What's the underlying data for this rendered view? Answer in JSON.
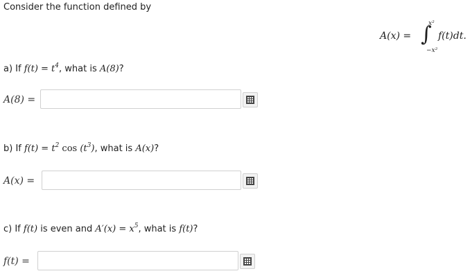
{
  "intro": "Consider the function defined by",
  "formula": {
    "lhs": "A(x) =",
    "upper_limit": "x²",
    "lower_limit": "−x²",
    "integrand": "f(t)dt."
  },
  "parts": [
    {
      "prefix": "a) If ",
      "condition_math": "f(t) = t",
      "condition_sup": "4",
      "question_sep": ", what is ",
      "target_math": "A(8)",
      "suffix": "?",
      "answer_label": "A(8) =",
      "answer_value": "",
      "answer_placeholder": ""
    },
    {
      "prefix": "b) If ",
      "condition_math": "f(t) = t",
      "condition_sup": "2",
      "cos": " cos",
      "cos_arg": " (t",
      "cos_arg_sup": "3",
      "cos_close": ")",
      "question_sep": ", what is ",
      "target_math": "A(x)",
      "suffix": "?",
      "answer_label": "A(x) =",
      "answer_value": "",
      "answer_placeholder": ""
    },
    {
      "prefix": "c) If ",
      "condition_math": "f(t)",
      "middle": " is even and ",
      "derivative_math": "A′(x) = x",
      "derivative_sup": "5",
      "question_sep": ", what is ",
      "target_math": "f(t)",
      "suffix": "?",
      "answer_label": "f(t) =",
      "answer_value": "",
      "answer_placeholder": ""
    }
  ],
  "icons": {
    "keypad": "calculator-keypad-icon"
  }
}
